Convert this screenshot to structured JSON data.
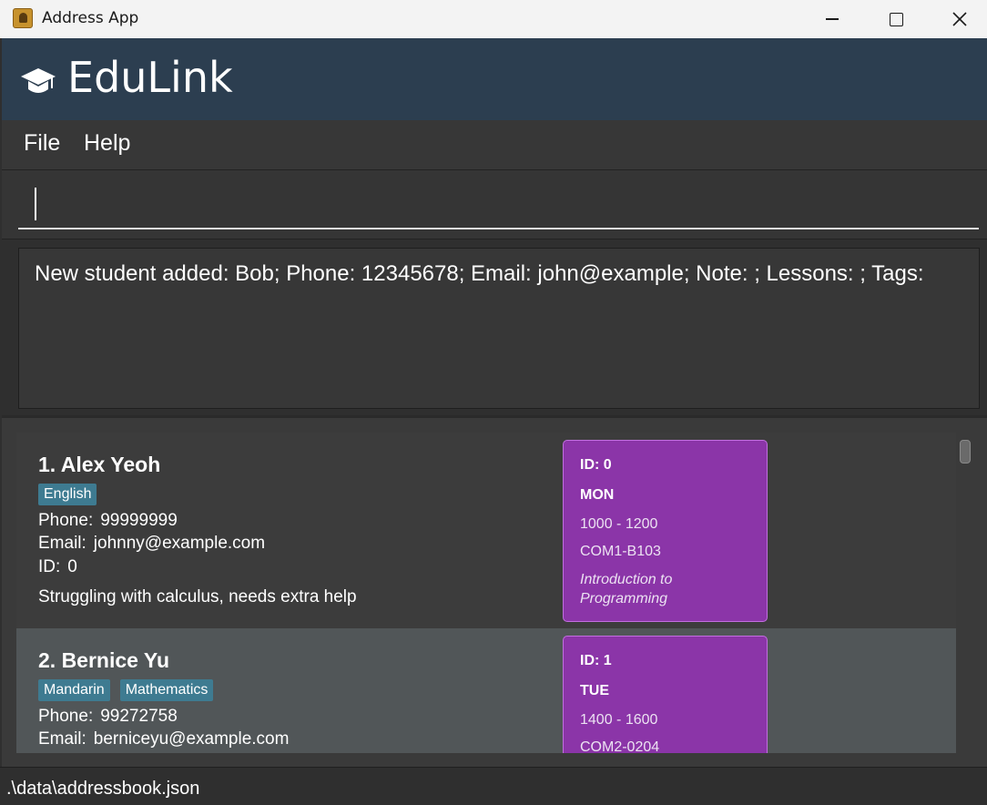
{
  "window": {
    "title": "Address App",
    "icon": "address-book-icon",
    "controls": [
      "minimize-icon",
      "maximize-icon",
      "close-icon"
    ]
  },
  "header": {
    "brand": "EduLink",
    "icon": "graduation-cap-icon",
    "background": "#2c3e50"
  },
  "menu": {
    "items": [
      {
        "label": "File"
      },
      {
        "label": "Help"
      }
    ]
  },
  "command": {
    "value": "",
    "placeholder": ""
  },
  "result": {
    "text": "New student added: Bob; Phone: 12345678; Email: john@example; Note: ; Lessons: ; Tags:"
  },
  "students": [
    {
      "name": "1. Alex Yeoh",
      "tags": [
        "English"
      ],
      "phone_label": "Phone:",
      "phone": "99999999",
      "email_label": "Email:",
      "email": "johnny@example.com",
      "id_label": "ID:",
      "id": "0",
      "note": "Struggling with calculus, needs extra help",
      "lesson": {
        "id": "ID: 0",
        "day": "MON",
        "time": "1000 - 1200",
        "venue": "COM1-B103",
        "subject": "Introduction to Programming"
      }
    },
    {
      "name": "2. Bernice Yu",
      "tags": [
        "Mandarin",
        "Mathematics"
      ],
      "phone_label": "Phone:",
      "phone": "99272758",
      "email_label": "Email:",
      "email": "berniceyu@example.com",
      "lesson": {
        "id": "ID: 1",
        "day": "TUE",
        "time": "1400 - 1600",
        "venue": "COM2-0204"
      }
    }
  ],
  "colors": {
    "tag": "#3e7b91",
    "lesson_card": "#8b35a8",
    "lesson_border": "#c26fe0"
  },
  "status": {
    "path": ".\\data\\addressbook.json"
  }
}
